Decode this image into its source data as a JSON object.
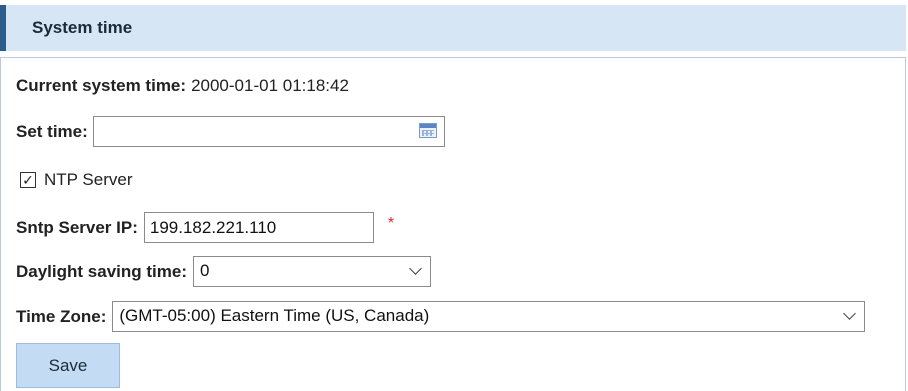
{
  "header": {
    "title": "System time"
  },
  "current_time": {
    "label": "Current system time:",
    "value": "2000-01-01 01:18:42"
  },
  "set_time": {
    "label": "Set time:",
    "value": "",
    "icon": "calendar-icon"
  },
  "ntp": {
    "label": "NTP Server",
    "checked": true,
    "check_glyph": "✓"
  },
  "sntp": {
    "label": "Sntp Server IP:",
    "value": "199.182.221.110",
    "required_mark": "*",
    "required_color": "#e0262c"
  },
  "daylight": {
    "label": "Daylight saving time:",
    "selected": "0"
  },
  "timezone": {
    "label": "Time Zone:",
    "selected": "(GMT-05:00) Eastern Time (US, Canada)"
  },
  "buttons": {
    "save": "Save"
  },
  "colors": {
    "header_bg": "#d6e6f5",
    "header_accent": "#2b5c8a",
    "button_bg": "#c4dcf3"
  }
}
